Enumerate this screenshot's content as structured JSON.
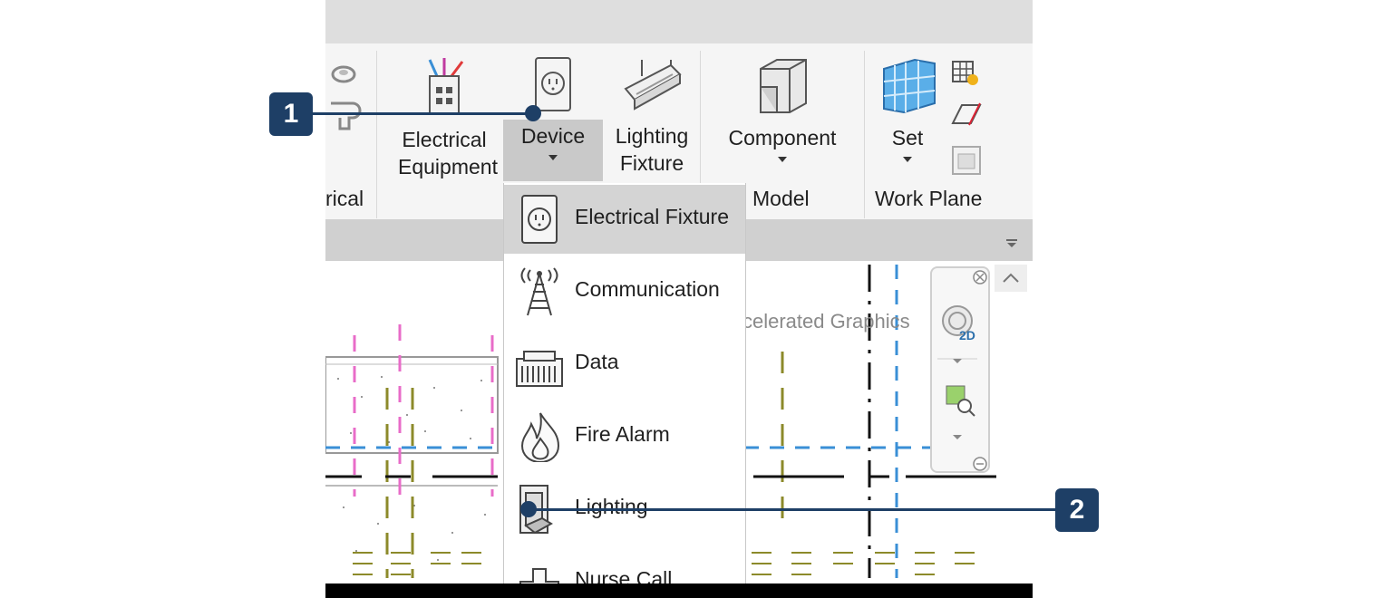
{
  "ribbon": {
    "electrical_equipment": {
      "line1": "Electrical",
      "line2": "Equipment"
    },
    "device": {
      "label": "Device"
    },
    "lighting_fixture": {
      "line1": "Lighting",
      "line2": "Fixture"
    },
    "component": {
      "label": "Component"
    },
    "set": {
      "label": "Set"
    },
    "panels": {
      "electrical_partial": "rical",
      "model": "Model",
      "work_plane": "Work Plane"
    }
  },
  "dropdown": {
    "items": [
      {
        "label": "Electrical Fixture",
        "icon": "electrical-fixture-icon"
      },
      {
        "label": "Communication",
        "icon": "communication-tower-icon"
      },
      {
        "label": "Data",
        "icon": "data-jack-icon"
      },
      {
        "label": "Fire Alarm",
        "icon": "fire-alarm-icon"
      },
      {
        "label": "Lighting",
        "icon": "lighting-switch-icon"
      },
      {
        "label": "Nurse Call",
        "icon": "nurse-call-icon"
      }
    ]
  },
  "canvas": {
    "ghost_text": "celerated Graphics"
  },
  "navbar": {
    "badge": "2D"
  },
  "callouts": [
    {
      "number": "1"
    },
    {
      "number": "2"
    }
  ],
  "colors": {
    "callout": "#1e3f66",
    "selected_item": "#d4d4d4",
    "dash_blue": "#3a8fd6",
    "dash_pink": "#e86cc8",
    "dash_olive": "#8c8a2a"
  }
}
